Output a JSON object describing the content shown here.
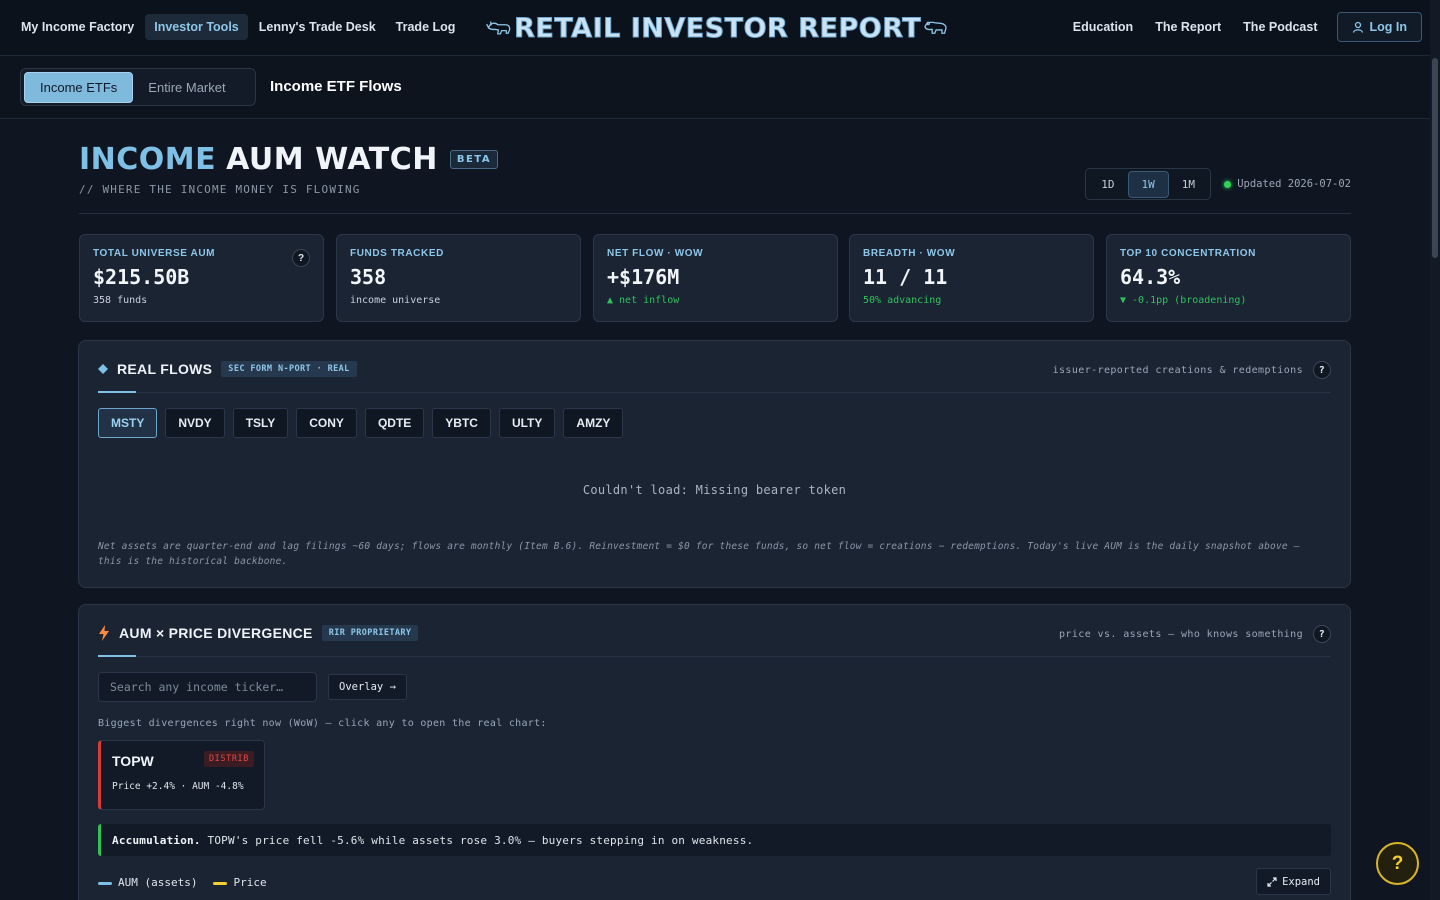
{
  "nav": {
    "left": [
      "My Income Factory",
      "Investor Tools",
      "Lenny's Trade Desk",
      "Trade Log"
    ],
    "brand": "RETAIL INVESTOR REPORT",
    "right": [
      "Education",
      "The Report",
      "The Podcast"
    ],
    "login": "Log In"
  },
  "subnav": {
    "tabs": [
      "Income ETFs",
      "Entire Market"
    ],
    "title": "Income ETF Flows"
  },
  "header": {
    "title_accent": "INCOME",
    "title_rest": "AUM WATCH",
    "badge": "BETA",
    "subtitle": "// WHERE THE INCOME MONEY IS FLOWING",
    "ranges": [
      "1D",
      "1W",
      "1M"
    ],
    "active_range": "1W",
    "updated": "Updated 2026-07-02"
  },
  "kpis": [
    {
      "label": "TOTAL UNIVERSE AUM",
      "value": "$215.50B",
      "note": "358 funds"
    },
    {
      "label": "FUNDS TRACKED",
      "value": "358",
      "note": "income universe"
    },
    {
      "label": "NET FLOW · WOW",
      "value": "+$176M",
      "note": "▲ net inflow"
    },
    {
      "label": "BREADTH · WOW",
      "value": "11 / 11",
      "note": "50% advancing"
    },
    {
      "label": "TOP 10 CONCENTRATION",
      "value": "64.3%",
      "note": "▼ -0.1pp (broadening)"
    }
  ],
  "real_flows": {
    "title": "REAL FLOWS",
    "tag": "SEC FORM N-PORT · REAL",
    "meta": "issuer-reported creations & redemptions",
    "tickers": [
      "MSTY",
      "NVDY",
      "TSLY",
      "CONY",
      "QDTE",
      "YBTC",
      "ULTY",
      "AMZY"
    ],
    "error": "Couldn't load: Missing bearer token",
    "footnote": "Net assets are quarter-end and lag filings ~60 days; flows are monthly (Item B.6). Reinvestment = $0 for these funds, so net flow = creations − redemptions. Today's live AUM is the daily snapshot above — this is the historical backbone."
  },
  "divergence": {
    "title": "AUM × PRICE DIVERGENCE",
    "tag": "RIR PROPRIETARY",
    "meta": "price vs. assets — who knows something",
    "search_placeholder": "Search any income ticker…",
    "overlay": "Overlay →",
    "hint": "Biggest divergences right now (WoW) — click any to open the real chart:",
    "card": {
      "ticker": "TOPW",
      "badge": "DISTRIB",
      "stats": "Price +2.4% · AUM -4.8%"
    },
    "accum_label": "Accumulation.",
    "accum_text": "TOPW's price fell -5.6% while assets rose 3.0% — buyers stepping in on weakness.",
    "legend": [
      {
        "label": "AUM (assets)",
        "color": "#7fc0e6"
      },
      {
        "label": "Price",
        "color": "#f3cf33"
      }
    ],
    "expand": "Expand"
  },
  "help_fab": "?"
}
